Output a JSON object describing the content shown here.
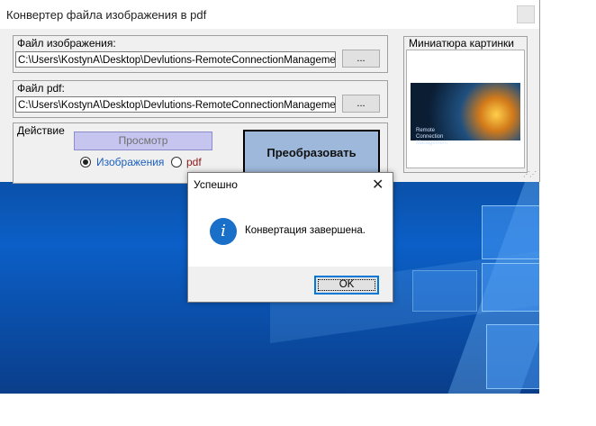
{
  "window": {
    "title": "Конвертер файла изображения в pdf"
  },
  "image_file": {
    "label": "Файл изображения:",
    "path": "C:\\Users\\KostynA\\Desktop\\Devlutions-RemoteConnectionManagement-S",
    "browse_label": "..."
  },
  "pdf_file": {
    "label": "Файл pdf:",
    "path": "C:\\Users\\KostynA\\Desktop\\Devlutions-RemoteConnectionManagement-S",
    "browse_label": "..."
  },
  "action": {
    "label": "Действие",
    "preview_label": "Просмотр",
    "radio_images_label": "Изображения",
    "radio_pdf_label": "pdf",
    "selected": "images"
  },
  "convert_label": "Преобразовать",
  "thumbnail": {
    "label": "Миниатюра картинки",
    "caption": "Remote Connection Management"
  },
  "dialog": {
    "title": "Успешно",
    "close_glyph": "✕",
    "icon": "info-icon",
    "icon_glyph": "i",
    "message": "Конвертация завершена.",
    "ok_label": "OK"
  },
  "colors": {
    "preview_button": "#c5c5ef",
    "convert_button": "#9db8da",
    "images_radio_text": "#1a5fbf",
    "pdf_radio_text": "#8b1a1a",
    "accent": "#0078d7"
  }
}
